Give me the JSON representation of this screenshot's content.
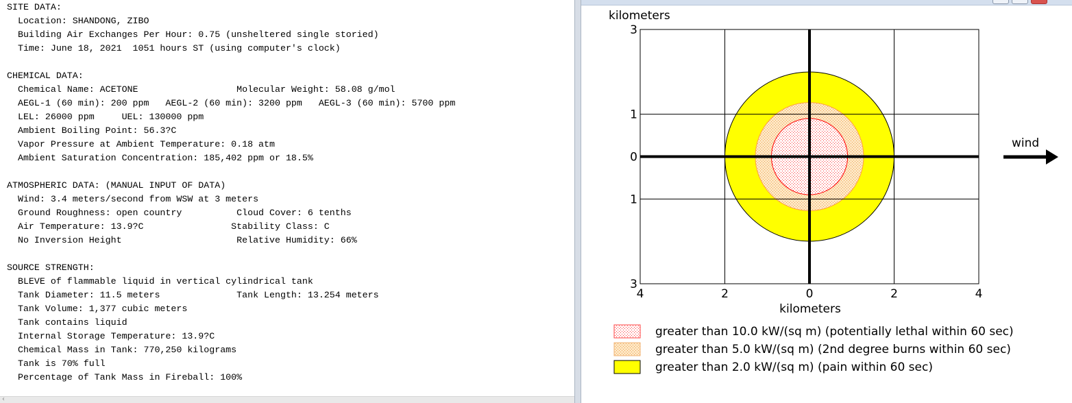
{
  "report": {
    "lines": [
      "SITE DATA:",
      "  Location: SHANDONG, ZIBO",
      "  Building Air Exchanges Per Hour: 0.75 (unsheltered single storied)",
      "  Time: June 18, 2021  1051 hours ST (using computer's clock)",
      "",
      "CHEMICAL DATA:",
      "  Chemical Name: ACETONE                  Molecular Weight: 58.08 g/mol",
      "  AEGL-1 (60 min): 200 ppm   AEGL-2 (60 min): 3200 ppm   AEGL-3 (60 min): 5700 ppm",
      "  LEL: 26000 ppm     UEL: 130000 ppm",
      "  Ambient Boiling Point: 56.3?C",
      "  Vapor Pressure at Ambient Temperature: 0.18 atm",
      "  Ambient Saturation Concentration: 185,402 ppm or 18.5%",
      "",
      "ATMOSPHERIC DATA: (MANUAL INPUT OF DATA)",
      "  Wind: 3.4 meters/second from WSW at 3 meters",
      "  Ground Roughness: open country          Cloud Cover: 6 tenths",
      "  Air Temperature: 13.9?C                Stability Class: C",
      "  No Inversion Height                     Relative Humidity: 66%",
      "",
      "SOURCE STRENGTH:",
      "  BLEVE of flammable liquid in vertical cylindrical tank",
      "  Tank Diameter: 11.5 meters              Tank Length: 13.254 meters",
      "  Tank Volume: 1,377 cubic meters",
      "  Tank contains liquid",
      "  Internal Storage Temperature: 13.9?C",
      "  Chemical Mass in Tank: 770,250 kilograms",
      "  Tank is 70% full",
      "  Percentage of Tank Mass in Fireball: 100%"
    ]
  },
  "scrollbar": {
    "left_arrow_icon": "chevron-left-icon",
    "left_arrow_glyph": "‹"
  },
  "chart_data": {
    "type": "threat-zone-map",
    "xlabel": "kilometers",
    "ylabel": "kilometers",
    "xlim": [
      -4,
      4
    ],
    "ylim": [
      -3,
      3
    ],
    "x_tick_labels": [
      "4",
      "2",
      "0",
      "2",
      "4"
    ],
    "x_tick_values": [
      -4,
      -2,
      0,
      2,
      4
    ],
    "y_tick_labels": [
      "3",
      "1",
      "0",
      "1",
      "3"
    ],
    "y_tick_values": [
      3,
      1,
      0,
      -1,
      -3
    ],
    "wind_label": "wind",
    "zones": [
      {
        "name": "greater than 2.0 kW/(sq m) (pain within 60 sec)",
        "radius_km": 2.0,
        "fill": "#ffff00",
        "pattern": "solid",
        "stroke": "#000000"
      },
      {
        "name": "greater than 5.0 kW/(sq m) (2nd degree burns within 60 sec)",
        "radius_km": 1.28,
        "fill": "#fbe2bc",
        "pattern": "dots-orange",
        "stroke": "#ffa040"
      },
      {
        "name": "greater than 10.0 kW/(sq m) (potentially lethal within 60 sec)",
        "radius_km": 0.9,
        "fill": "#ffffff",
        "pattern": "dots-red",
        "stroke": "#ff0000"
      }
    ],
    "legend": [
      {
        "label": "greater than 10.0 kW/(sq m) (potentially lethal within 60 sec)",
        "pattern": "dots-red"
      },
      {
        "label": "greater than 5.0 kW/(sq m) (2nd degree burns within 60 sec)",
        "pattern": "dots-orange"
      },
      {
        "label": "greater than 2.0 kW/(sq m) (pain within 60 sec)",
        "pattern": "solid-yellow"
      }
    ]
  }
}
